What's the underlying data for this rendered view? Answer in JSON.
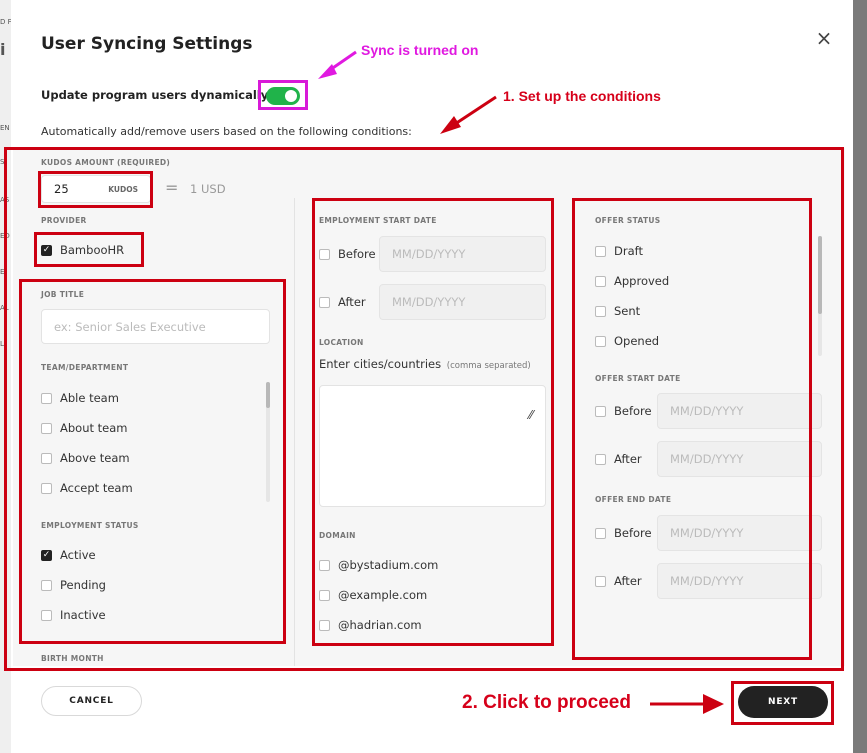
{
  "dialog": {
    "title": "User Syncing Settings",
    "close_icon": "×",
    "sync_label": "Update program users dynamically",
    "sync_enabled": true,
    "description": "Automatically add/remove users based on the following conditions:"
  },
  "left_column": {
    "kudos": {
      "label": "KUDOS AMOUNT (REQUIRED)",
      "value": "25",
      "unit": "KUDOS",
      "equals": "=",
      "conversion": "1 USD"
    },
    "provider": {
      "label": "PROVIDER",
      "option": "BambooHR",
      "checked": true
    },
    "job_title": {
      "label": "JOB TITLE",
      "placeholder": "ex: Senior Sales Executive"
    },
    "team": {
      "label": "TEAM/DEPARTMENT",
      "options": [
        "Able team",
        "About team",
        "Above team",
        "Accept team"
      ]
    },
    "employment_status": {
      "label": "EMPLOYMENT STATUS",
      "options": [
        {
          "label": "Active",
          "checked": true
        },
        {
          "label": "Pending",
          "checked": false
        },
        {
          "label": "Inactive",
          "checked": false
        }
      ]
    },
    "birth_month_label": "BIRTH MONTH"
  },
  "middle_column": {
    "start_date": {
      "label": "EMPLOYMENT START DATE",
      "before": "Before",
      "after": "After",
      "placeholder": "MM/DD/YYYY"
    },
    "location": {
      "label": "LOCATION",
      "prompt": "Enter cities/countries",
      "hint": "(comma separated)"
    },
    "domain": {
      "label": "DOMAIN",
      "options": [
        "@bystadium.com",
        "@example.com",
        "@hadrian.com"
      ]
    }
  },
  "right_column": {
    "offer_status": {
      "label": "OFFER STATUS",
      "options": [
        "Draft",
        "Approved",
        "Sent",
        "Opened"
      ]
    },
    "offer_start_date": {
      "label": "OFFER START DATE",
      "before": "Before",
      "after": "After",
      "placeholder": "MM/DD/YYYY"
    },
    "offer_end_date": {
      "label": "OFFER END DATE",
      "before": "Before",
      "after": "After",
      "placeholder": "MM/DD/YYYY"
    }
  },
  "footer": {
    "cancel_label": "CANCEL",
    "next_label": "NEXT"
  },
  "annotations": {
    "sync_on": "Sync is turned on",
    "setup": "1. Set up the conditions",
    "proceed": "2. Click to proceed"
  },
  "colors": {
    "toggle_on": "#20b34a",
    "annotation_red": "#cc0011",
    "annotation_magenta": "#e019e0",
    "next_button": "#222222"
  }
}
